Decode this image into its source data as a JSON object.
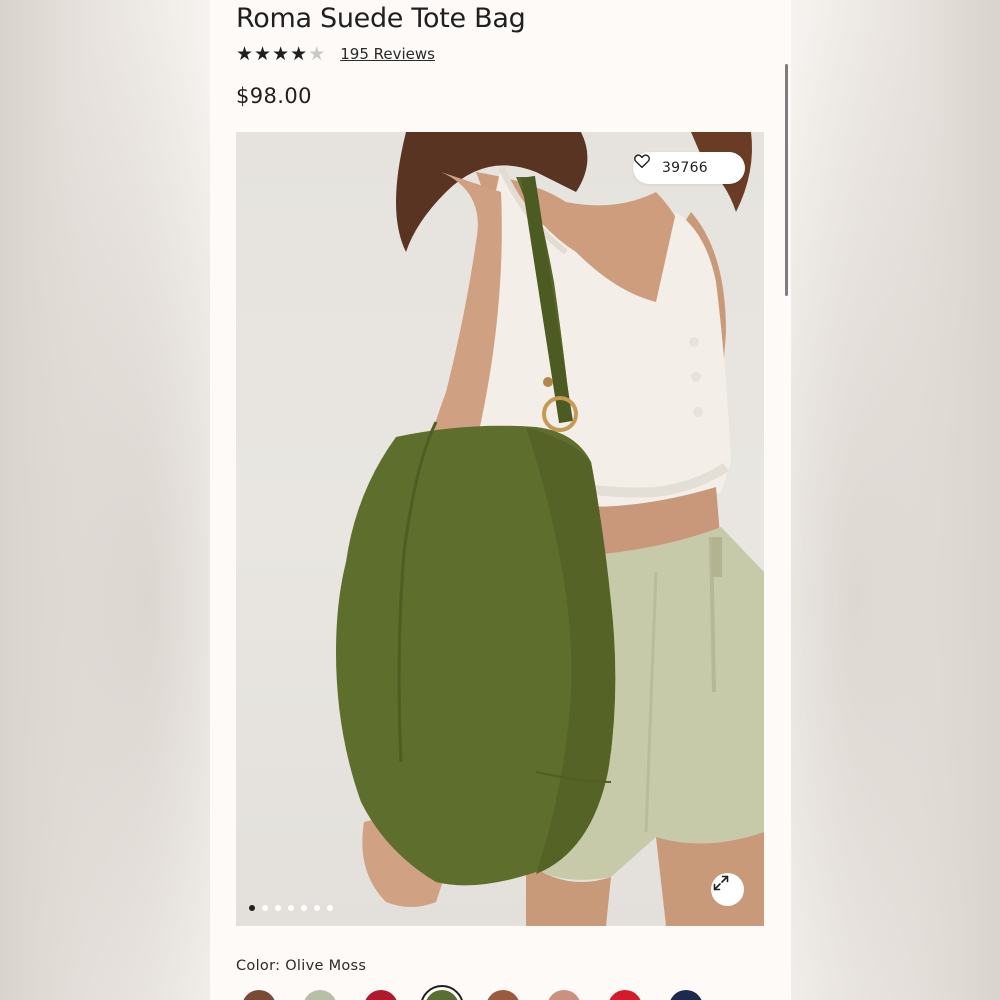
{
  "product": {
    "title": "Roma Suede Tote Bag",
    "rating": 4,
    "rating_max": 5,
    "reviews_label": "195 Reviews",
    "price": "$98.00"
  },
  "gallery": {
    "like_count": "39766",
    "slide_count": 7,
    "active_slide": 0
  },
  "color": {
    "label": "Color: Olive Moss",
    "swatches": [
      {
        "name": "brown",
        "hex": "#7a4a35"
      },
      {
        "name": "sage",
        "hex": "#b7bfa6"
      },
      {
        "name": "red",
        "hex": "#b0192b"
      },
      {
        "name": "olive-moss",
        "hex": "#5a6e33",
        "selected": true
      },
      {
        "name": "rust",
        "hex": "#9b5a3f"
      },
      {
        "name": "blush",
        "hex": "#cd8f7f"
      },
      {
        "name": "bright-red",
        "hex": "#d31c2a"
      },
      {
        "name": "navy",
        "hex": "#1c2a4e"
      }
    ]
  },
  "colors": {
    "text": "#1f1f1f",
    "page_bg": "#fdfaf8",
    "bag": "#5b6b2c",
    "shorts": "#c8cba9",
    "top": "#f1ede6"
  }
}
